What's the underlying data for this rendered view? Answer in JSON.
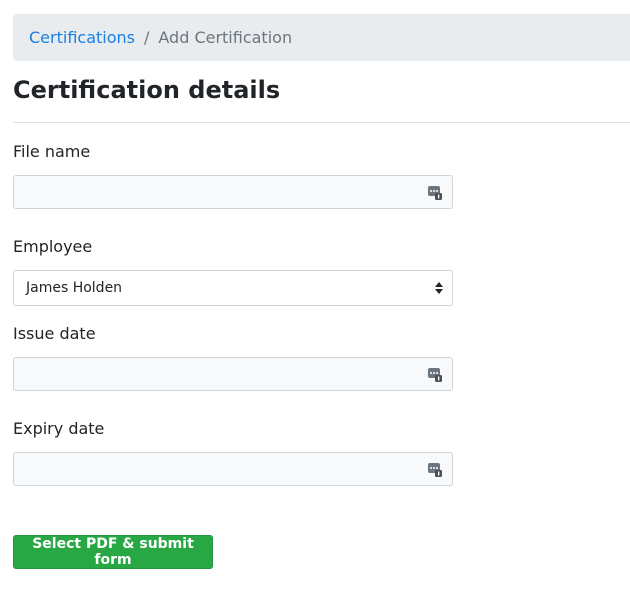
{
  "breadcrumb": {
    "parent": "Certifications",
    "separator": "/",
    "current": "Add Certification"
  },
  "page": {
    "title": "Certification details"
  },
  "form": {
    "file_name": {
      "label": "File name",
      "value": ""
    },
    "employee": {
      "label": "Employee",
      "selected": "James Holden"
    },
    "issue_date": {
      "label": "Issue date",
      "value": ""
    },
    "expiry_date": {
      "label": "Expiry date",
      "value": ""
    },
    "submit_label": "Select PDF & submit form"
  },
  "icons": {
    "field_icon": "password-manager-icon",
    "select_icon": "sort-arrows-icon"
  },
  "colors": {
    "link": "#1a7ee3",
    "submit": "#28a745"
  }
}
